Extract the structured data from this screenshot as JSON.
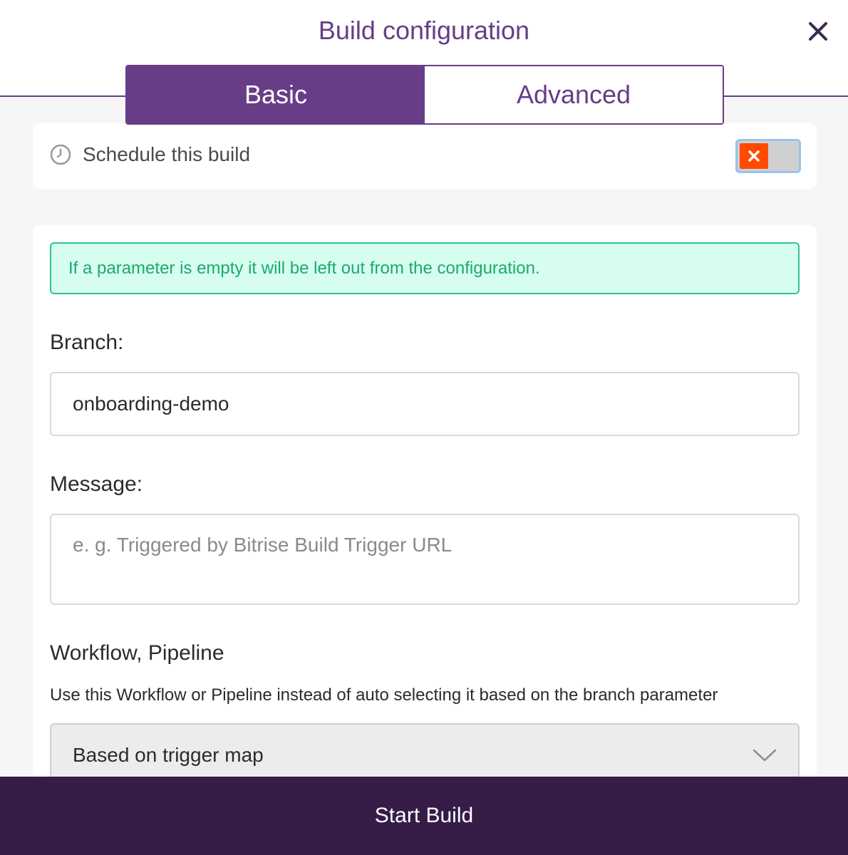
{
  "dialog": {
    "title": "Build configuration",
    "close_icon": "close-icon"
  },
  "tabs": [
    {
      "label": "Basic",
      "active": true
    },
    {
      "label": "Advanced",
      "active": false
    }
  ],
  "schedule": {
    "icon": "clock-icon",
    "label": "Schedule this build",
    "enabled": false,
    "toggle_icon": "x-icon"
  },
  "form": {
    "notice": "If a parameter is empty it will be left out from the configuration.",
    "branch": {
      "label": "Branch:",
      "value": "onboarding-demo"
    },
    "message": {
      "label": "Message:",
      "value": "",
      "placeholder": "e. g. Triggered by Bitrise Build Trigger URL"
    },
    "workflow": {
      "heading": "Workflow, Pipeline",
      "helper": "Use this Workflow or Pipeline instead of auto selecting it based on the branch parameter",
      "selected": "Based on trigger map",
      "icon": "chevron-down-icon"
    }
  },
  "footer": {
    "start_label": "Start Build"
  },
  "colors": {
    "brand": "#683d87",
    "footer": "#351d48",
    "notice_bg": "#d6fdf0",
    "notice_text": "#1daa6c",
    "toggle_off": "#ff4a00"
  }
}
